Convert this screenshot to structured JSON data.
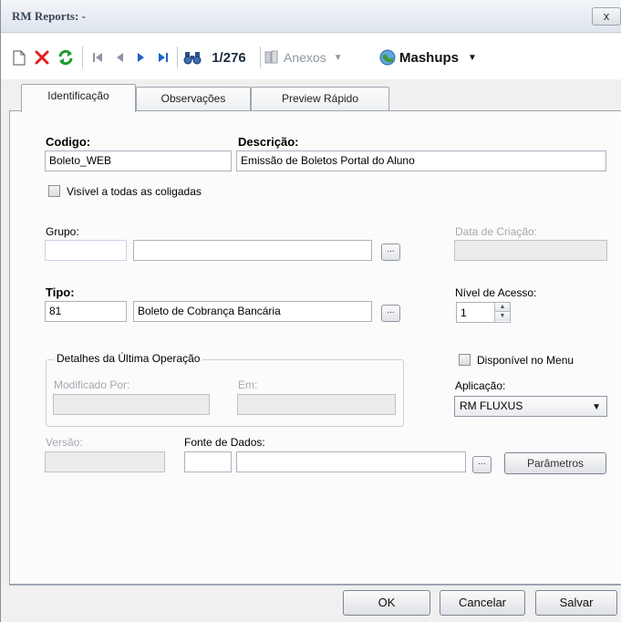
{
  "window": {
    "title": "RM Reports: -",
    "close_symbol": "x"
  },
  "toolbar": {
    "record_position": "1/276",
    "attachments_label": "Anexos",
    "mashups_label": "Mashups"
  },
  "tabs": [
    {
      "label": "Identificação",
      "active": true
    },
    {
      "label": "Observações",
      "active": false
    },
    {
      "label": "Preview Rápido",
      "active": false
    }
  ],
  "form": {
    "codigo_label": "Codigo:",
    "codigo_value": "Boleto_WEB",
    "descricao_label": "Descrição:",
    "descricao_value": "Emissão de Boletos Portal do Aluno",
    "visivel_label": "Visível a todas as coligadas",
    "grupo_label": "Grupo:",
    "grupo_code": "",
    "grupo_desc": "",
    "data_criacao_label": "Data de Criação:",
    "data_criacao_value": "",
    "tipo_label": "Tipo:",
    "tipo_code": "81",
    "tipo_desc": "Boleto de Cobrança Bancária",
    "nivel_label": "Nível de Acesso:",
    "nivel_value": "1",
    "detalhes_label": "Detalhes da Última Operação",
    "modificado_label": "Modificado Por:",
    "modificado_value": "",
    "em_label": "Em:",
    "em_value": "",
    "disponivel_label": "Disponível no Menu",
    "aplicacao_label": "Aplicação:",
    "aplicacao_value": "RM FLUXUS",
    "versao_label": "Versão:",
    "versao_value": "",
    "fonte_label": "Fonte de Dados:",
    "fonte_code": "",
    "fonte_desc": "",
    "lookup_symbol": "...",
    "parametros_label": "Parâmetros"
  },
  "footer": {
    "ok_label": "OK",
    "cancel_label": "Cancelar",
    "save_label": "Salvar"
  }
}
